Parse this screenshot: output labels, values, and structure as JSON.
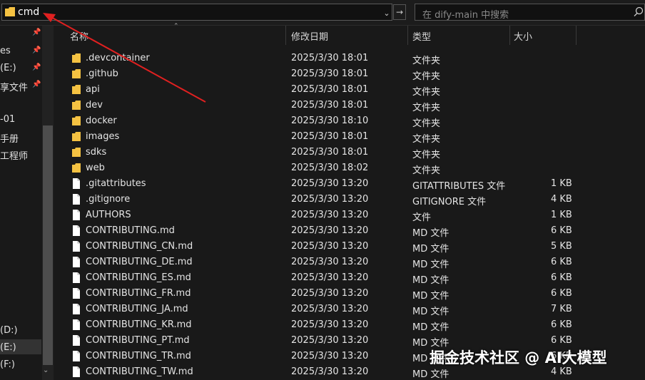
{
  "address_bar": {
    "path": "cmd",
    "folder_icon": "folder-icon",
    "color_folder": "#f5c242"
  },
  "search": {
    "placeholder": "在 dify-main 中搜索"
  },
  "sidebar": {
    "items": [
      {
        "label": "es",
        "pinned": true
      },
      {
        "label": "(E:)",
        "pinned": true
      },
      {
        "label": "享文件",
        "pinned": true
      },
      {
        "label": "-01",
        "pinned": false
      },
      {
        "label": "手册",
        "pinned": false
      },
      {
        "label": "工程师",
        "pinned": false
      },
      {
        "label": "(D:)",
        "pinned": false
      },
      {
        "label": "(E:)",
        "pinned": false
      },
      {
        "label": "(F:)",
        "pinned": false
      }
    ]
  },
  "columns": {
    "name": "名称",
    "date": "修改日期",
    "type": "类型",
    "size": "大小"
  },
  "files": [
    {
      "name": ".devcontainer",
      "date": "2025/3/30 18:01",
      "type": "文件夹",
      "size": "",
      "icon": "folder"
    },
    {
      "name": ".github",
      "date": "2025/3/30 18:01",
      "type": "文件夹",
      "size": "",
      "icon": "folder"
    },
    {
      "name": "api",
      "date": "2025/3/30 18:01",
      "type": "文件夹",
      "size": "",
      "icon": "folder"
    },
    {
      "name": "dev",
      "date": "2025/3/30 18:01",
      "type": "文件夹",
      "size": "",
      "icon": "folder"
    },
    {
      "name": "docker",
      "date": "2025/3/30 18:10",
      "type": "文件夹",
      "size": "",
      "icon": "folder"
    },
    {
      "name": "images",
      "date": "2025/3/30 18:01",
      "type": "文件夹",
      "size": "",
      "icon": "folder"
    },
    {
      "name": "sdks",
      "date": "2025/3/30 18:01",
      "type": "文件夹",
      "size": "",
      "icon": "folder"
    },
    {
      "name": "web",
      "date": "2025/3/30 18:02",
      "type": "文件夹",
      "size": "",
      "icon": "folder"
    },
    {
      "name": ".gitattributes",
      "date": "2025/3/30 13:20",
      "type": "GITATTRIBUTES 文件",
      "size": "1 KB",
      "icon": "file"
    },
    {
      "name": ".gitignore",
      "date": "2025/3/30 13:20",
      "type": "GITIGNORE 文件",
      "size": "4 KB",
      "icon": "file"
    },
    {
      "name": "AUTHORS",
      "date": "2025/3/30 13:20",
      "type": "文件",
      "size": "1 KB",
      "icon": "file"
    },
    {
      "name": "CONTRIBUTING.md",
      "date": "2025/3/30 13:20",
      "type": "MD 文件",
      "size": "6 KB",
      "icon": "file"
    },
    {
      "name": "CONTRIBUTING_CN.md",
      "date": "2025/3/30 13:20",
      "type": "MD 文件",
      "size": "5 KB",
      "icon": "file"
    },
    {
      "name": "CONTRIBUTING_DE.md",
      "date": "2025/3/30 13:20",
      "type": "MD 文件",
      "size": "6 KB",
      "icon": "file"
    },
    {
      "name": "CONTRIBUTING_ES.md",
      "date": "2025/3/30 13:20",
      "type": "MD 文件",
      "size": "6 KB",
      "icon": "file"
    },
    {
      "name": "CONTRIBUTING_FR.md",
      "date": "2025/3/30 13:20",
      "type": "MD 文件",
      "size": "6 KB",
      "icon": "file"
    },
    {
      "name": "CONTRIBUTING_JA.md",
      "date": "2025/3/30 13:20",
      "type": "MD 文件",
      "size": "7 KB",
      "icon": "file"
    },
    {
      "name": "CONTRIBUTING_KR.md",
      "date": "2025/3/30 13:20",
      "type": "MD 文件",
      "size": "6 KB",
      "icon": "file"
    },
    {
      "name": "CONTRIBUTING_PT.md",
      "date": "2025/3/30 13:20",
      "type": "MD 文件",
      "size": "6 KB",
      "icon": "file"
    },
    {
      "name": "CONTRIBUTING_TR.md",
      "date": "2025/3/30 13:20",
      "type": "MD 文件",
      "size": "6 KB",
      "icon": "file"
    },
    {
      "name": "CONTRIBUTING_TW.md",
      "date": "2025/3/30 13:20",
      "type": "MD 文件",
      "size": "4 KB",
      "icon": "file"
    }
  ],
  "watermark": "掘金技术社区 @ AI大模型",
  "annotation": {
    "arrow_color": "#e02020"
  }
}
